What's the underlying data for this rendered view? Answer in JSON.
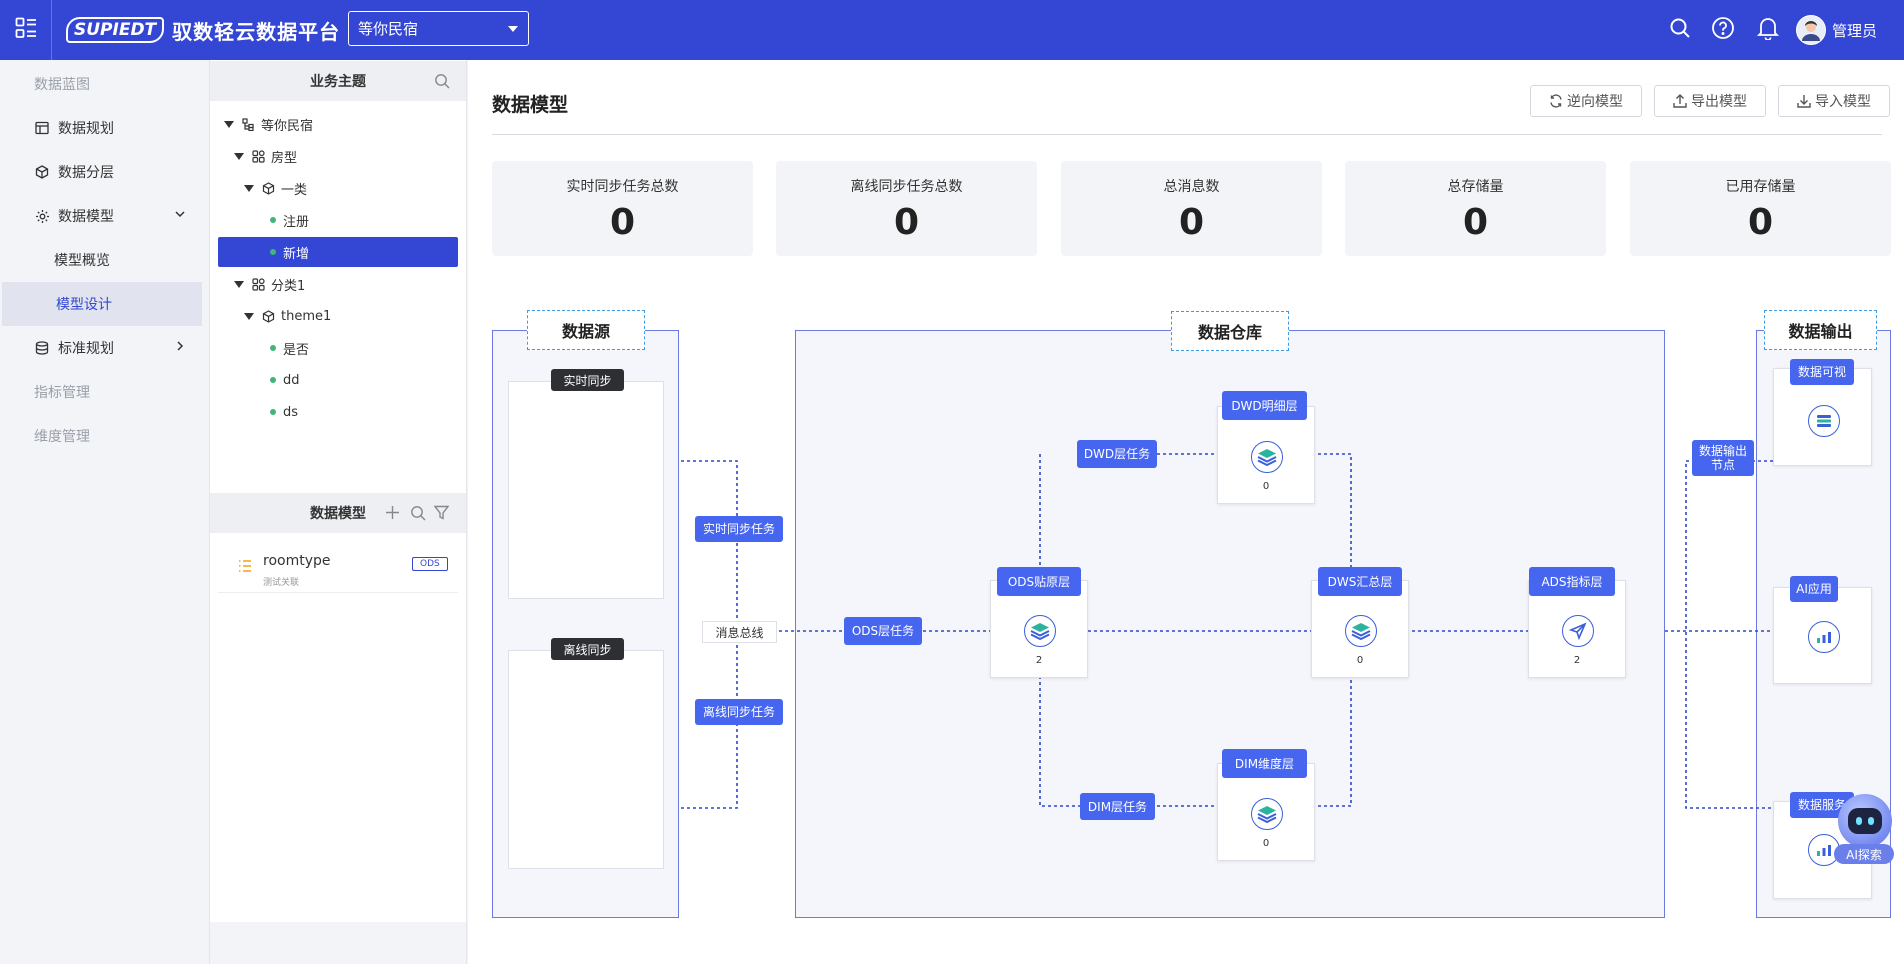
{
  "header": {
    "logo_mark": "SUPIEDT",
    "app_name": "驭数轻云数据平台",
    "project": "等你民宿",
    "user_name": "管理员"
  },
  "nav": {
    "section_blueprint": "数据蓝图",
    "planning": "数据规划",
    "layering": "数据分层",
    "model": "数据模型",
    "model_overview": "模型概览",
    "model_design": "模型设计",
    "standards": "标准规划",
    "metrics": "指标管理",
    "dimensions": "维度管理"
  },
  "tree": {
    "title": "业务主题",
    "items": [
      {
        "label": "等你民宿"
      },
      {
        "label": "房型"
      },
      {
        "label": "一类"
      },
      {
        "label": "注册"
      },
      {
        "label": "新增"
      },
      {
        "label": "分类1"
      },
      {
        "label": "theme1"
      },
      {
        "label": "是否"
      },
      {
        "label": "dd"
      },
      {
        "label": "ds"
      }
    ]
  },
  "models": {
    "title": "数据模型",
    "items": [
      {
        "name": "roomtype",
        "desc": "测试关联",
        "badge": "ODS"
      }
    ]
  },
  "main": {
    "title": "数据模型",
    "buttons": {
      "reverse": "逆向模型",
      "export": "导出模型",
      "import": "导入模型"
    },
    "stats": [
      {
        "label": "实时同步任务总数",
        "value": "0"
      },
      {
        "label": "离线同步任务总数",
        "value": "0"
      },
      {
        "label": "总消息数",
        "value": "0"
      },
      {
        "label": "总存储量",
        "value": "0"
      },
      {
        "label": "已用存储量",
        "value": "0"
      }
    ]
  },
  "diagram": {
    "source_title": "数据源",
    "warehouse_title": "数据仓库",
    "output_title": "数据输出",
    "realtime_sync": "实时同步",
    "offline_sync": "离线同步",
    "realtime_task": "实时同步任务",
    "offline_task": "离线同步任务",
    "bus": "消息总线",
    "ods_task": "ODS层任务",
    "dwd_task": "DWD层任务",
    "dim_task": "DIM层任务",
    "output_node": "数据输出节点",
    "nodes": {
      "ods": {
        "label": "ODS贴原层",
        "count": "2"
      },
      "dwd": {
        "label": "DWD明细层",
        "count": "0"
      },
      "dws": {
        "label": "DWS汇总层",
        "count": "0"
      },
      "dim": {
        "label": "DIM维度层",
        "count": "0"
      },
      "ads": {
        "label": "ADS指标层",
        "count": "2"
      }
    },
    "outputs": {
      "visual": "数据可视",
      "ai_app": "AI应用",
      "service": "数据服务"
    }
  },
  "assistant": {
    "label": "AI探索"
  },
  "colors": {
    "primary": "#3446d4",
    "tag_blue": "#4766f0",
    "dot_green": "#3fb67b"
  }
}
